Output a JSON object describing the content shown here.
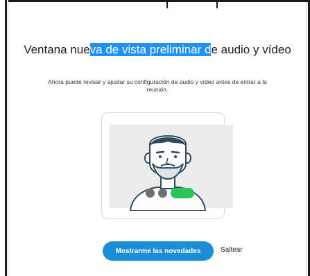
{
  "dialog": {
    "title_before": "Ventana nue",
    "title_highlight": "va de vista preliminar d",
    "title_after": "e audio y vídeo",
    "subtitle": "Ahora puede revisar y ajustar su configuración de audio y vídeo antes de entrar a la reunión.",
    "preview": {
      "avatar_icon": "bearded-person-illustration",
      "controls": [
        "mute-dot",
        "video-dot",
        "join-pill"
      ],
      "colors": {
        "dot": "#6f6f6f",
        "pill": "#29c45a"
      }
    },
    "primary_button": "Mostrarme las novedades",
    "skip_link": "Saltear"
  },
  "colors": {
    "accent": "#1a8fd6",
    "highlight": "#1e90ff"
  }
}
